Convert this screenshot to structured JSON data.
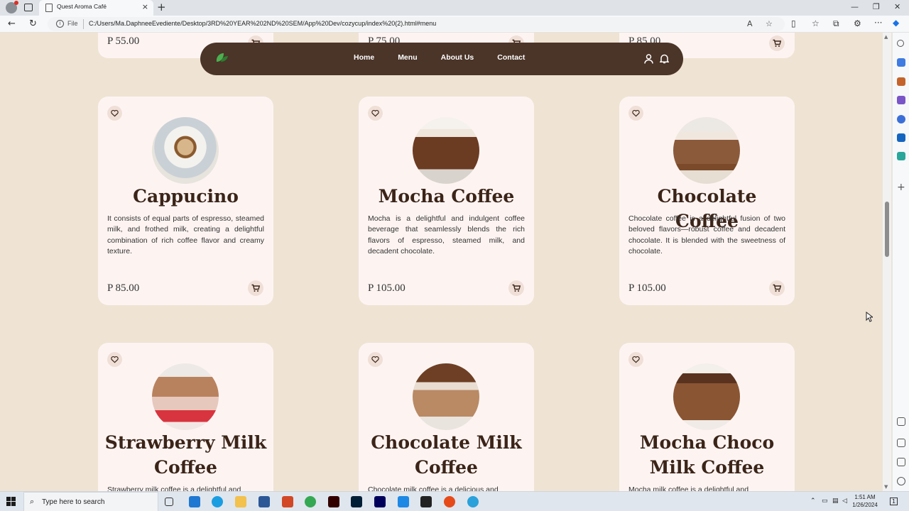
{
  "browser": {
    "tab_title": "Quest Aroma Café",
    "tab_close": "×",
    "new_tab": "+",
    "url_scheme": "File",
    "url": "C:/Users/Ma.DaphneeEvediente/Desktop/3RD%20YEAR%202ND%20SEM/App%20Dev/cozycup/index%20(2).html#menu",
    "minimize": "—",
    "maximize": "❐",
    "close": "✕"
  },
  "navbar": {
    "links": [
      "Home",
      "Menu",
      "About Us",
      "Contact"
    ]
  },
  "top_prices": [
    "P 55.00",
    "P 75.00",
    "P 85.00"
  ],
  "products": [
    {
      "name": "Cappucino",
      "description": "It consists of equal parts of espresso, steamed milk, and frothed milk, creating a delightful combination of rich coffee flavor and creamy texture.",
      "price": "P 85.00"
    },
    {
      "name": "Mocha Coffee",
      "description": "Mocha is a delightful and indulgent coffee beverage that seamlessly blends the rich flavors of espresso, steamed milk, and decadent chocolate.",
      "price": "P 105.00"
    },
    {
      "name": "Chocolate Coffee",
      "description": "Chocolate coffee is a delightful fusion of two beloved flavors—robust coffee and decadent chocolate. It is blended with the sweetness of chocolate.",
      "price": "P 105.00"
    },
    {
      "name_line1": "Strawberry Milk",
      "name_line2": "Coffee",
      "description": "Strawberry milk coffee is a delightful and"
    },
    {
      "name_line1": "Chocolate Milk",
      "name_line2": "Coffee",
      "description": "Chocolate milk coffee is a delicious and"
    },
    {
      "name_line1": "Mocha Choco",
      "name_line2": "Milk Coffee",
      "description": "Mocha milk coffee is a delightful and"
    }
  ],
  "taskbar": {
    "search_placeholder": "Type here to search",
    "time": "1:51 AM",
    "date": "1/26/2024",
    "notification_count": "1"
  },
  "colors": {
    "page_bg": "#efe3d3",
    "card_bg": "#fdf4f2",
    "navbar_bg": "#4b3428",
    "heading": "#3b2418"
  }
}
